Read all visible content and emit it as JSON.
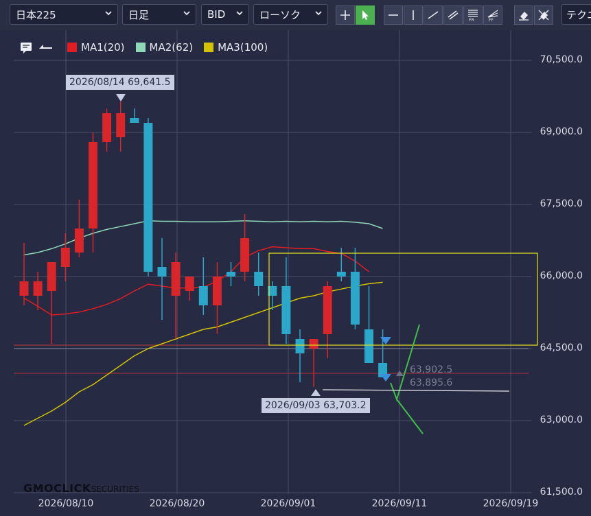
{
  "toolbar": {
    "symbol": "日本225",
    "timeframe": "日足",
    "price_type": "BID",
    "chart_type": "ローソク",
    "technical": "テクニ"
  },
  "legend": [
    {
      "label": "MA1(20)",
      "color": "#e11d22"
    },
    {
      "label": "MA2(62)",
      "color": "#8fd8b8"
    },
    {
      "label": "MA3(100)",
      "color": "#d4c300"
    }
  ],
  "tooltips": {
    "high": "2026/08/14 69,641.5",
    "low": "2026/09/03 63,703.2"
  },
  "price_markers": {
    "a": "63,902.5",
    "b": "63,895.6"
  },
  "logo": {
    "brand": "GMOCLICK",
    "suffix": "SECURITIES"
  },
  "colors": {
    "up": "#d9262b",
    "down": "#2aa7c9",
    "box": "#e6e61a",
    "background": "#262a42"
  },
  "chart_data": {
    "type": "candlestick",
    "y_axis": {
      "ticks": [
        "70,500.0",
        "69,000.0",
        "67,500.0",
        "66,000.0",
        "64,500.0",
        "63,000.0",
        "61,500.0"
      ],
      "range": [
        61500,
        70500
      ]
    },
    "x_axis": {
      "ticks": [
        "2026/08/10",
        "2026/08/20",
        "2026/09/01",
        "2026/09/11",
        "2026/09/19"
      ]
    },
    "candles": [
      {
        "o": 65600,
        "h": 66700,
        "l": 65400,
        "c": 65900
      },
      {
        "o": 65600,
        "h": 66100,
        "l": 65300,
        "c": 65900
      },
      {
        "o": 65700,
        "h": 66200,
        "l": 64600,
        "c": 66300
      },
      {
        "o": 66200,
        "h": 66900,
        "l": 65900,
        "c": 66600
      },
      {
        "o": 66500,
        "h": 67600,
        "l": 66400,
        "c": 67000
      },
      {
        "o": 67000,
        "h": 69000,
        "l": 66500,
        "c": 68800
      },
      {
        "o": 68800,
        "h": 69500,
        "l": 68600,
        "c": 69400
      },
      {
        "o": 68900,
        "h": 69641.5,
        "l": 68600,
        "c": 69400
      },
      {
        "o": 69300,
        "h": 69500,
        "l": 69200,
        "c": 69200
      },
      {
        "o": 69200,
        "h": 69300,
        "l": 66000,
        "c": 66100
      },
      {
        "o": 66200,
        "h": 66800,
        "l": 65100,
        "c": 66000
      },
      {
        "o": 65600,
        "h": 66500,
        "l": 64700,
        "c": 66300
      },
      {
        "o": 65700,
        "h": 66000,
        "l": 65500,
        "c": 66000
      },
      {
        "o": 65800,
        "h": 66400,
        "l": 65200,
        "c": 65400
      },
      {
        "o": 65400,
        "h": 66300,
        "l": 64800,
        "c": 66000
      },
      {
        "o": 66100,
        "h": 66300,
        "l": 65800,
        "c": 66000
      },
      {
        "o": 66100,
        "h": 67300,
        "l": 65900,
        "c": 66800
      },
      {
        "o": 66100,
        "h": 66500,
        "l": 65600,
        "c": 65800
      },
      {
        "o": 65800,
        "h": 65900,
        "l": 65300,
        "c": 65600
      },
      {
        "o": 65800,
        "h": 66400,
        "l": 64600,
        "c": 64800
      },
      {
        "o": 64700,
        "h": 64900,
        "l": 63800,
        "c": 64400
      },
      {
        "o": 64500,
        "h": 64700,
        "l": 63703.2,
        "c": 64700
      },
      {
        "o": 64800,
        "h": 65900,
        "l": 64300,
        "c": 65800
      },
      {
        "o": 66100,
        "h": 66600,
        "l": 65900,
        "c": 66000
      },
      {
        "o": 66100,
        "h": 66600,
        "l": 64900,
        "c": 65000
      },
      {
        "o": 64900,
        "h": 65800,
        "l": 64300,
        "c": 64200
      },
      {
        "o": 64200,
        "h": 64900,
        "l": 63900,
        "c": 63902.5
      }
    ],
    "series": [
      {
        "name": "MA1(20)",
        "values": [
          65550,
          65380,
          65200,
          65220,
          65260,
          65330,
          65420,
          65540,
          65700,
          65840,
          65800,
          65760,
          65760,
          65780,
          65900,
          66100,
          66400,
          66540,
          66620,
          66600,
          66580,
          66580,
          66520,
          66480,
          66320,
          66100
        ]
      },
      {
        "name": "MA2(62)",
        "values": [
          66450,
          66500,
          66580,
          66680,
          66800,
          66900,
          66980,
          67040,
          67100,
          67160,
          67150,
          67150,
          67140,
          67140,
          67140,
          67150,
          67160,
          67150,
          67140,
          67150,
          67140,
          67150,
          67140,
          67150,
          67130,
          67100,
          67000
        ]
      },
      {
        "name": "MA3(100)",
        "values": [
          62900,
          63050,
          63200,
          63380,
          63600,
          63750,
          63950,
          64150,
          64350,
          64500,
          64600,
          64700,
          64800,
          64900,
          64950,
          65050,
          65150,
          65250,
          65350,
          65450,
          65550,
          65600,
          65680,
          65740,
          65800,
          65850,
          65880
        ]
      }
    ]
  }
}
